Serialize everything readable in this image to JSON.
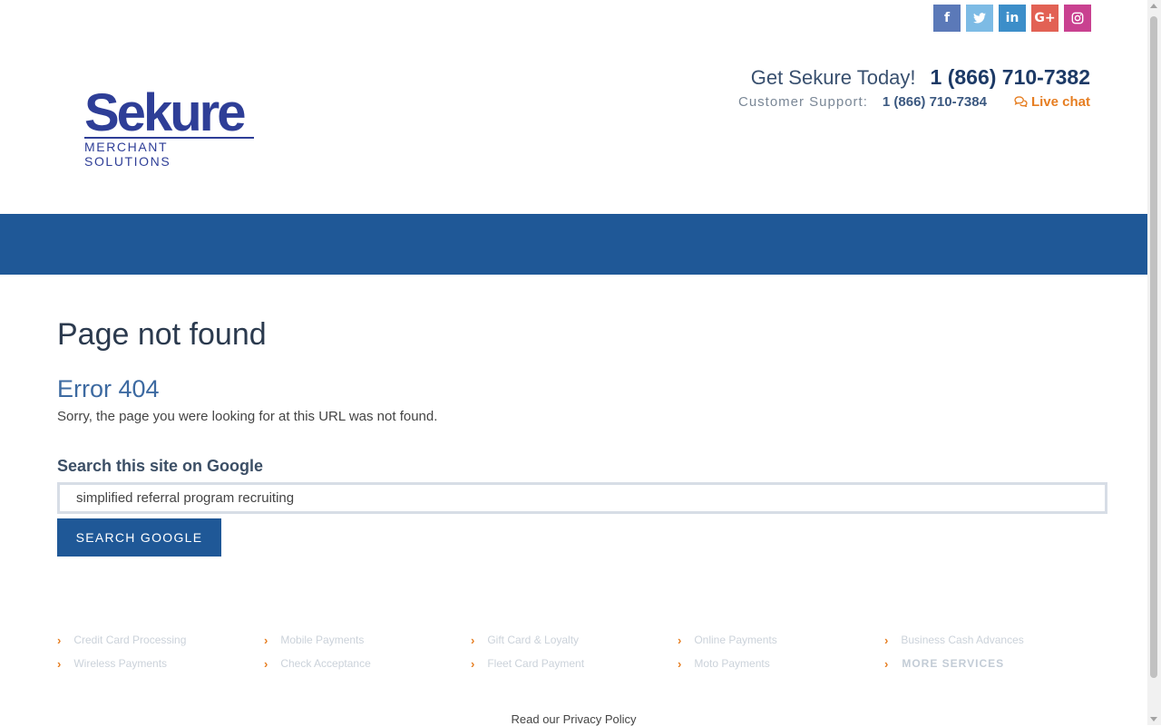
{
  "social": [
    {
      "name": "facebook",
      "glyph": "f"
    },
    {
      "name": "twitter",
      "glyph": "t"
    },
    {
      "name": "linkedin",
      "glyph": "in"
    },
    {
      "name": "googleplus",
      "glyph": "G+"
    },
    {
      "name": "instagram",
      "glyph": "◎"
    }
  ],
  "logo": {
    "brand": "Sekure",
    "tagline": "MERCHANT SOLUTIONS"
  },
  "contact": {
    "cta": "Get Sekure Today!",
    "sales_phone": "1 (866) 710-7382",
    "support_label": "Customer Support:",
    "support_phone": "1 (866) 710-7384",
    "chat_icon": "chat-bubbles-icon",
    "chat_label": "Live chat"
  },
  "main": {
    "title": "Page not found",
    "error": "Error 404",
    "message": "Sorry, the page you were looking for at this URL was not found.",
    "search_label": "Search this site on Google",
    "search_value": "simplified referral program recruiting",
    "search_button": "SEARCH GOOGLE"
  },
  "services": [
    "Credit Card Processing",
    "Mobile Payments",
    "Gift Card & Loyalty",
    "Online Payments",
    "Business Cash Advances",
    "Wireless Payments",
    "Check Acceptance",
    "Fleet Card Payment",
    "Moto Payments",
    "MORE SERVICES"
  ],
  "footer": {
    "privacy": "Read our Privacy Policy"
  },
  "colors": {
    "primary": "#1f5897",
    "accent": "#e67e22",
    "logo": "#2e3e97"
  }
}
